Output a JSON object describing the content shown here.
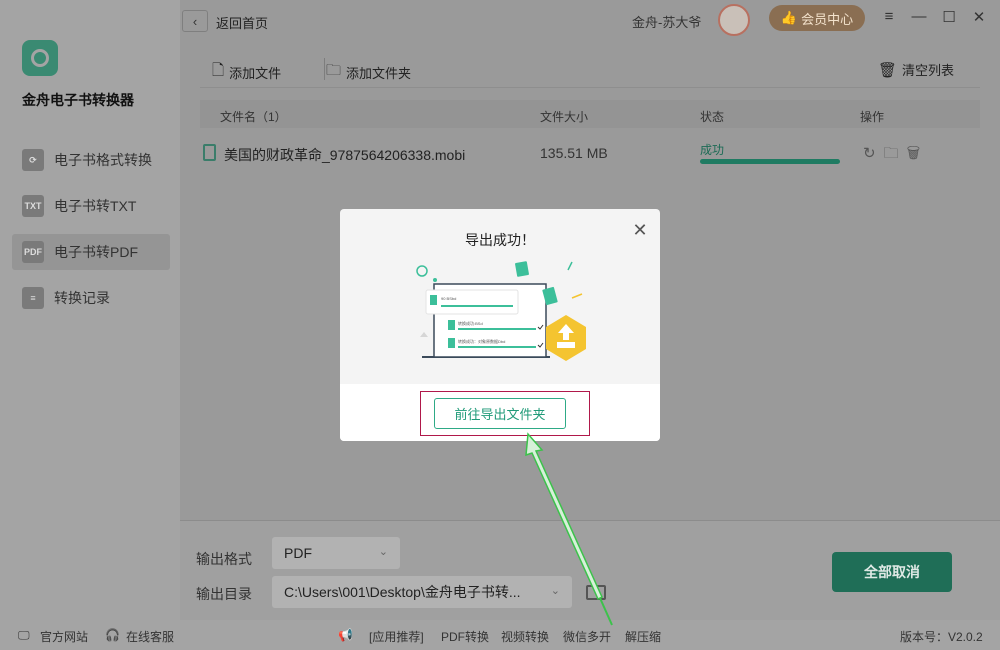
{
  "app": {
    "name": "金舟电子书转换器"
  },
  "sidebar": {
    "items": [
      {
        "label": "电子书格式转换",
        "icon": "refresh-icon",
        "badge": ""
      },
      {
        "label": "电子书转TXT",
        "icon": "txt-icon",
        "badge": "TXT"
      },
      {
        "label": "电子书转PDF",
        "icon": "pdf-icon",
        "badge": "PDF",
        "active": true
      },
      {
        "label": "转换记录",
        "icon": "history-icon",
        "badge": ""
      }
    ]
  },
  "topbar": {
    "back_label": "返回首页",
    "username": "金舟-苏大爷",
    "vip_label": "会员中心"
  },
  "toolbar": {
    "add_file": "添加文件",
    "add_folder": "添加文件夹",
    "clear_list": "清空列表"
  },
  "table": {
    "headers": {
      "name": "文件名（1）",
      "size": "文件大小",
      "status": "状态",
      "ops": "操作"
    },
    "rows": [
      {
        "name": "美国的财政革命_9787564206338.mobi",
        "size": "135.51 MB",
        "status": "成功",
        "progress": 1.0
      }
    ]
  },
  "output": {
    "format_label": "输出格式",
    "format_value": "PDF",
    "dir_label": "输出目录",
    "dir_value": "C:\\Users\\001\\Desktop\\金舟电子书转..."
  },
  "cancel_all": "全部取消",
  "status_bar": {
    "website": "官方网站",
    "support": "在线客服",
    "recommend": "[应用推荐]",
    "links": [
      "PDF转换",
      "视频转换",
      "微信多开",
      "解压缩"
    ],
    "version": "版本号：V2.0.2"
  },
  "modal": {
    "title": "导出成功！",
    "open_folder": "前往导出文件夹",
    "illus_lines": [
      "90 BSbd",
      "转换成功:BSd",
      "转换成功：对象原数据Dbd"
    ]
  },
  "colors": {
    "accent": "#2eaa86",
    "highlight": "#b0184a",
    "arrow": "#3cc24b"
  }
}
